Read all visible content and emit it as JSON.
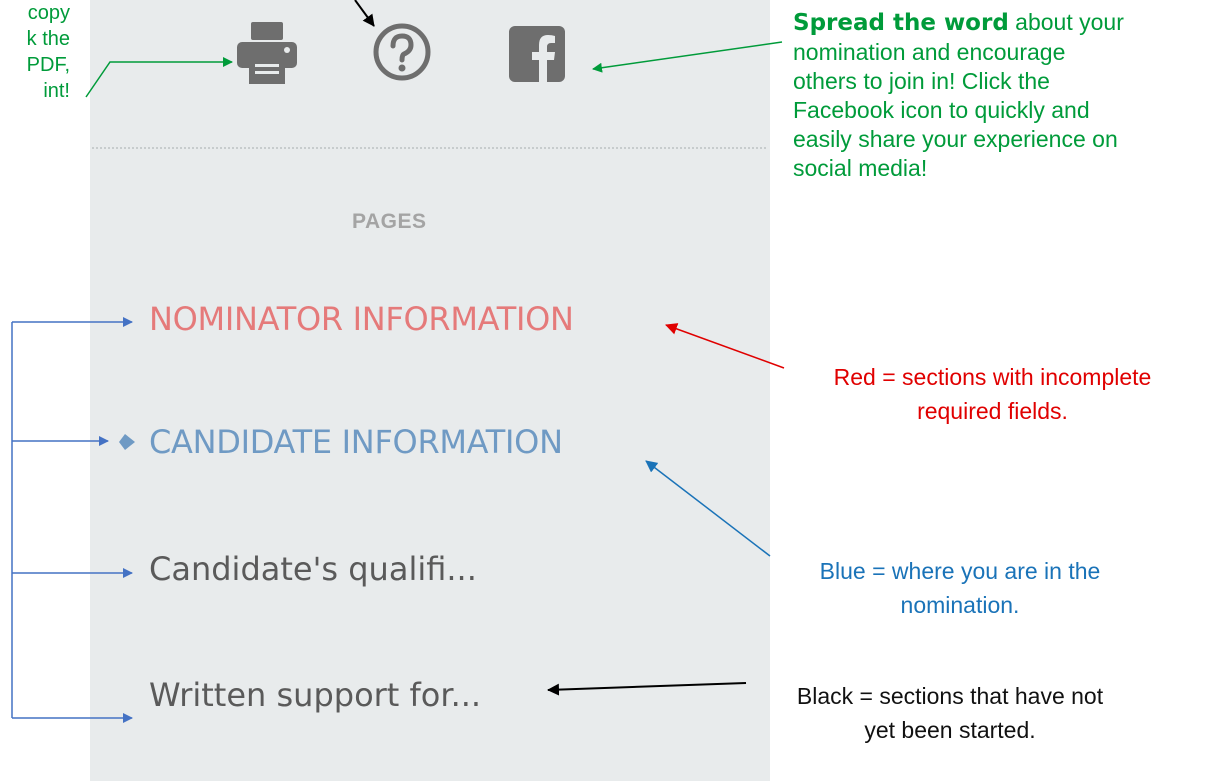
{
  "sidebar": {
    "pages_heading": "PAGES",
    "items": [
      {
        "label": "NOMINATOR INFORMATION",
        "state": "incomplete"
      },
      {
        "label": "CANDIDATE INFORMATION",
        "state": "current"
      },
      {
        "label": "Candidate's qualifi...",
        "state": "not-started"
      },
      {
        "label": "Written support for...",
        "state": "not-started"
      }
    ]
  },
  "toolbar": {
    "icons": [
      "print-icon",
      "help-icon",
      "facebook-icon"
    ]
  },
  "annotations": {
    "left_fragment": [
      "copy",
      "k   the",
      "PDF,",
      "int!"
    ],
    "facebook_bold": "Spread the word",
    "facebook_lines": [
      " about your",
      "nomination and encourage",
      "others to join in!  Click the",
      "Facebook icon to quickly and",
      "easily share your experience on",
      "social media!"
    ],
    "red_lines": [
      "Red = sections with incomplete",
      "required fields."
    ],
    "blue_lines": [
      "Blue = where you are in the",
      "nomination."
    ],
    "black_lines": [
      "Black = sections that have not",
      "yet been started."
    ]
  },
  "colors": {
    "incomplete": "#e57a7a",
    "current": "#6f9ac4",
    "not_started": "#5a5a5a",
    "annotation_green": "#009b3a",
    "annotation_red": "#e00000",
    "annotation_blue": "#1a73b8",
    "panel_background": "#e8ebec"
  }
}
